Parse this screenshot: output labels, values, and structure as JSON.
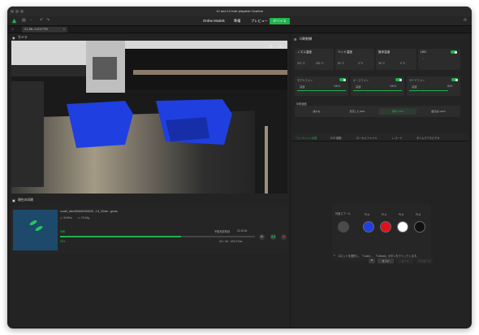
{
  "window": {
    "title": "12 and 14 hole playable Ocarina"
  },
  "menu": {
    "tabs": [
      "Online Models",
      "準備",
      "プレビュー",
      "デバイス"
    ],
    "active": "デバイス"
  },
  "file_tab": {
    "label": "X1-1BL-H-EXCT99"
  },
  "camera": {
    "label": "カメラ"
  },
  "print_job": {
    "section_label": "現在の印刷",
    "file_name": "model_ebbc830b694300f39...1.8_35min...gcode",
    "time_label": "3h 50m",
    "weight_label": "79.16g",
    "status": "印刷",
    "finish_label": "予想完成時刻",
    "finish_time": "22:15:04",
    "progress": 0.62,
    "percent": "62%",
    "layers": "2/1 / 40 ~ 40h 27mn"
  },
  "control": {
    "section_label": "印刷制御",
    "nozzle": {
      "title": "ノズル温度",
      "current": "221 °C",
      "target": "220 °C"
    },
    "bed": {
      "title": "ベッド温度",
      "current": "90 °C",
      "target": "0 °C"
    },
    "chamber": {
      "title": "筐体温度",
      "current": "35 °C",
      "target": "0 °C"
    },
    "led": "LED",
    "fans": [
      {
        "name": "モデルファン",
        "mode": "高速",
        "value": 1.0,
        "label": "100%"
      },
      {
        "name": "ケースファン",
        "mode": "高速",
        "value": 1.0,
        "label": "100%"
      },
      {
        "name": "サイドファン",
        "mode": "高速",
        "value": 0.8,
        "label": "80%"
      }
    ],
    "speed": {
      "title": "印刷速度",
      "options": [
        "静かな",
        "安定した 80%",
        "標準 100%",
        "超高速 120%"
      ],
      "active": 2
    }
  },
  "device_tabs": {
    "items": [
      "フィラメント状態",
      "XYZ 制御",
      "ローカルファイル",
      "レコード",
      "タイムラプスビデオ"
    ],
    "active": 0
  },
  "ams": {
    "external_label": "外部スプール",
    "slots": [
      {
        "type": "PLA",
        "color": "#1f3fe0"
      },
      {
        "type": "PLA",
        "color": "#e01020"
      },
      {
        "type": "PLA",
        "color": "#ffffff"
      },
      {
        "type": "PLA",
        "color": "#111111"
      }
    ],
    "hint": "スロットを選択し、「Load」、「Unload」ボタンをクリックします。",
    "buttons": [
      "ガイド",
      "ロード",
      "アンロード"
    ]
  }
}
